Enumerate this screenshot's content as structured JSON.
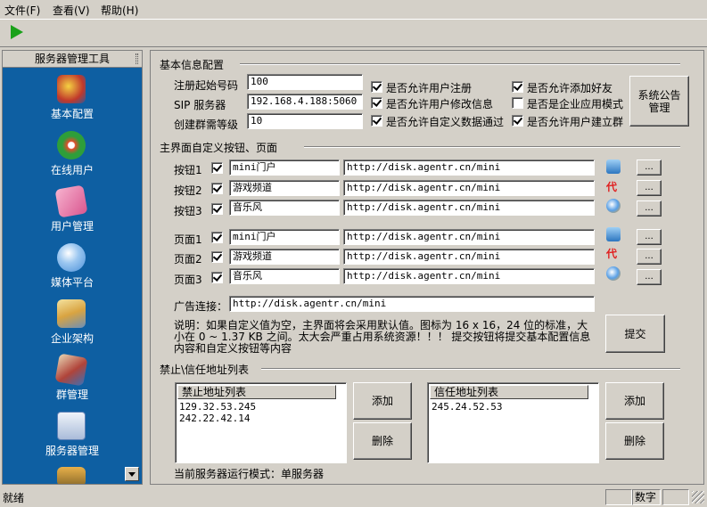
{
  "menu": [
    {
      "label": "文件(F)"
    },
    {
      "label": "查看(V)"
    },
    {
      "label": "帮助(H)"
    }
  ],
  "sidebar": {
    "title": "服务器管理工具",
    "items": [
      {
        "label": "基本配置",
        "icon": "basic-config-icon",
        "color": "#c0392b"
      },
      {
        "label": "在线用户",
        "icon": "online-users-icon",
        "color": "#2e9e3a"
      },
      {
        "label": "用户管理",
        "icon": "user-management-icon",
        "color": "#d9568f"
      },
      {
        "label": "媒体平台",
        "icon": "media-platform-icon",
        "color": "#4a90d9"
      },
      {
        "label": "企业架构",
        "icon": "enterprise-structure-icon",
        "color": "#d9a441"
      },
      {
        "label": "群管理",
        "icon": "group-management-icon",
        "color": "#b0443a"
      },
      {
        "label": "服务器管理",
        "icon": "server-management-icon",
        "color": "#5b7fb5"
      }
    ]
  },
  "basic": {
    "section_title": "基本信息配置",
    "reg_start_label": "注册起始号码",
    "reg_start_value": "100",
    "sip_label": "SIP 服务器",
    "sip_value": "192.168.4.188:5060",
    "group_level_label": "创建群需等级",
    "group_level_value": "10",
    "checks": [
      {
        "label": "是否允许用户注册",
        "checked": true
      },
      {
        "label": "是否允许用户修改信息",
        "checked": true
      },
      {
        "label": "是否允许自定义数据通过",
        "checked": true
      },
      {
        "label": "是否允许添加好友",
        "checked": true
      },
      {
        "label": "是否是企业应用模式",
        "checked": false
      },
      {
        "label": "是否允许用户建立群",
        "checked": true
      }
    ],
    "announce_button": "系统公告管理"
  },
  "custom": {
    "section_title": "主界面自定义按钮、页面",
    "buttons": [
      {
        "label": "按钮1",
        "name": "mini门户",
        "url": "http://disk.agentr.cn/mini",
        "icon": "ie-icon"
      },
      {
        "label": "按钮2",
        "name": "游戏频道",
        "url": "http://disk.agentr.cn/mini",
        "icon": "dai-icon",
        "icon_text": "代"
      },
      {
        "label": "按钮3",
        "name": "音乐风",
        "url": "http://disk.agentr.cn/mini",
        "icon": "music-search-icon"
      }
    ],
    "pages": [
      {
        "label": "页面1",
        "name": "mini门户",
        "url": "http://disk.agentr.cn/mini",
        "icon": "ie-icon"
      },
      {
        "label": "页面2",
        "name": "游戏频道",
        "url": "http://disk.agentr.cn/mini",
        "icon": "dai-icon",
        "icon_text": "代"
      },
      {
        "label": "页面3",
        "name": "音乐风",
        "url": "http://disk.agentr.cn/mini",
        "icon": "music-search-icon"
      }
    ],
    "browse_label": "...",
    "ad_label": "广告连接：",
    "ad_value": "http://disk.agentr.cn/mini",
    "note": "说明：如果自定义值为空，主界面将会采用默认值。图标为 16 x 16，24 位的标准，大小在 0 ~ 1.37 KB 之间。太大会严重占用系统资源！！！ 提交按钮将提交基本配置信息内容和自定义按钮等内容",
    "submit_button": "提交"
  },
  "address": {
    "section_title": "禁止\\信任地址列表",
    "blocked_header": "禁止地址列表",
    "blocked": [
      "129.32.53.245",
      "242.22.42.14"
    ],
    "trusted_header": "信任地址列表",
    "trusted": [
      "245.24.52.53"
    ],
    "add_label": "添加",
    "delete_label": "删除",
    "mode_text": "当前服务器运行模式：单服务器"
  },
  "status": {
    "ready": "就绪",
    "numlock": "数字"
  }
}
